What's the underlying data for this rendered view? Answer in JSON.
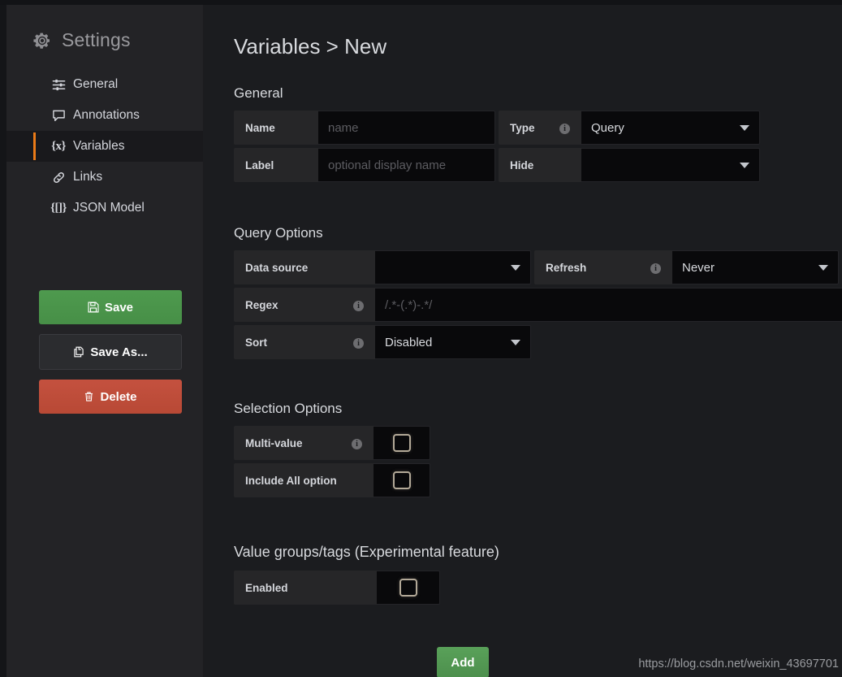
{
  "sidebar": {
    "header": {
      "title": "Settings",
      "icon": "gear-icon"
    },
    "items": [
      {
        "label": "General",
        "icon": "sliders-icon",
        "active": false
      },
      {
        "label": "Annotations",
        "icon": "comment-icon",
        "active": false
      },
      {
        "label": "Variables",
        "icon": "variable-icon",
        "glyph": "{x}",
        "active": true
      },
      {
        "label": "Links",
        "icon": "link-icon",
        "active": false
      },
      {
        "label": "JSON Model",
        "icon": "braces-icon",
        "glyph": "{[]}",
        "active": false
      }
    ],
    "buttons": [
      {
        "label": "Save",
        "icon": "floppy-disk-icon",
        "style": "primary",
        "color": "#4e9a4e"
      },
      {
        "label": "Save As...",
        "icon": "copy-icon",
        "style": "secondary",
        "color": "#2b2c2f"
      },
      {
        "label": "Delete",
        "icon": "trash-icon",
        "style": "danger",
        "color": "#c4513f"
      }
    ]
  },
  "main": {
    "page_title": "Variables > New",
    "sections": {
      "general": {
        "title": "General",
        "name": {
          "label": "Name",
          "placeholder": "name",
          "value": ""
        },
        "label": {
          "label": "Label",
          "placeholder": "optional display name",
          "value": ""
        },
        "type": {
          "label": "Type",
          "value": "Query",
          "info": true
        },
        "hide": {
          "label": "Hide",
          "value": "",
          "info": false
        }
      },
      "query_options": {
        "title": "Query Options",
        "data_source": {
          "label": "Data source",
          "value": "",
          "info": false
        },
        "refresh": {
          "label": "Refresh",
          "value": "Never",
          "info": true
        },
        "regex": {
          "label": "Regex",
          "placeholder": "/.*-(.*)-.*/",
          "value": "",
          "info": true
        },
        "sort": {
          "label": "Sort",
          "value": "Disabled",
          "info": true
        }
      },
      "selection_options": {
        "title": "Selection Options",
        "multi_value": {
          "label": "Multi-value",
          "checked": false,
          "info": true
        },
        "include_all": {
          "label": "Include All option",
          "checked": false,
          "info": false
        }
      },
      "value_groups": {
        "title": "Value groups/tags (Experimental feature)",
        "enabled": {
          "label": "Enabled",
          "checked": false,
          "info": false
        }
      }
    },
    "add_button": "Add",
    "watermark": "https://blog.csdn.net/weixin_43697701"
  },
  "colors": {
    "accent": "#eb7b18",
    "sidebar_bg": "#232326",
    "main_bg": "#1b1c1f",
    "field_bg": "#09090b",
    "label_bg": "#262628",
    "save_green": "#4e9a4e",
    "delete_red": "#c4513f"
  }
}
